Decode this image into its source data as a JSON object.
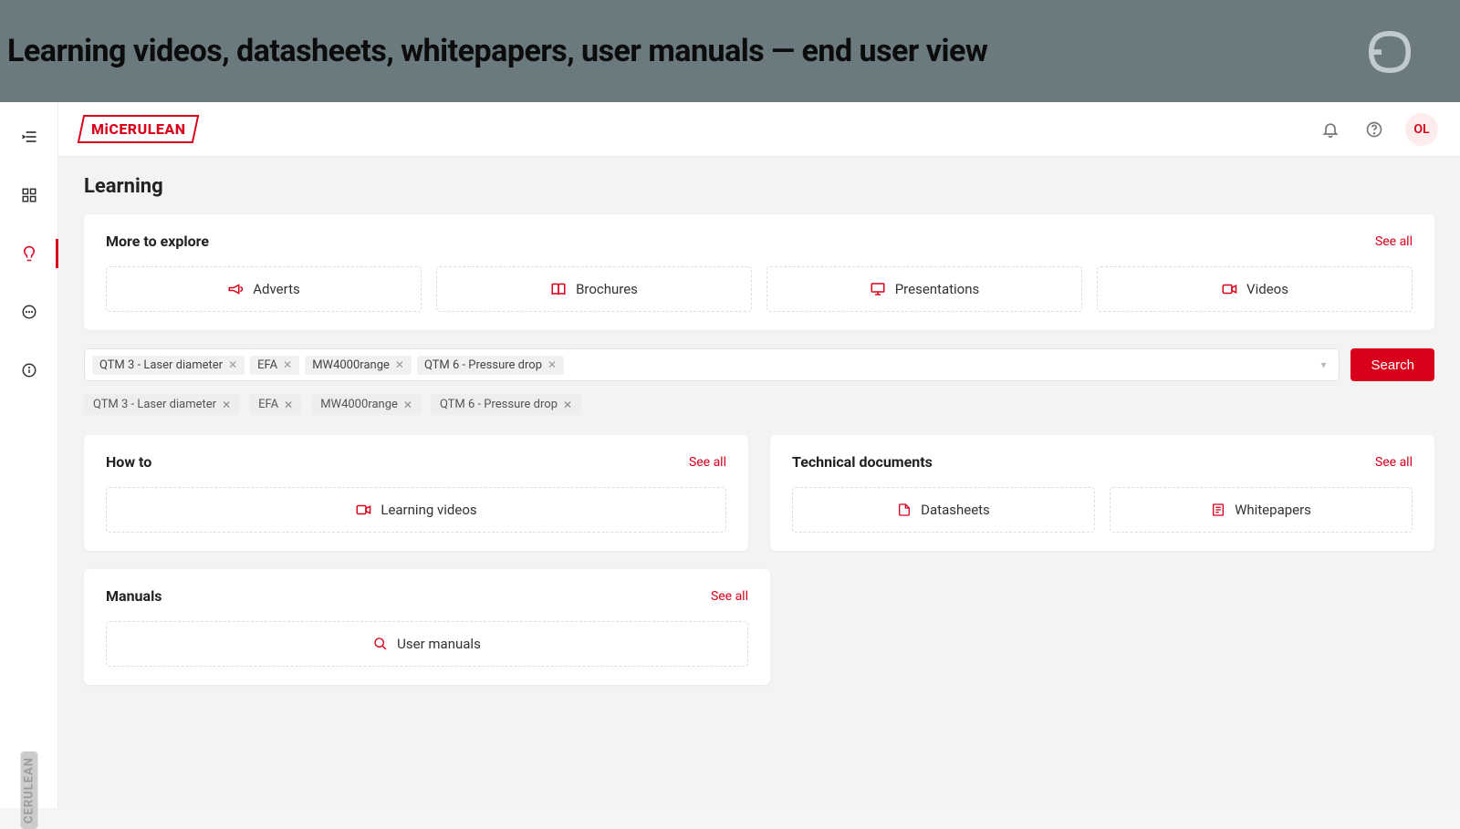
{
  "banner": {
    "title": "Learning videos, datasheets, whitepapers, user manuals — end user view"
  },
  "topbar": {
    "logo": "MiCERULEAN",
    "avatar": "OL"
  },
  "page": {
    "title": "Learning"
  },
  "explore": {
    "title": "More to explore",
    "see_all": "See all",
    "tiles": {
      "adverts": "Adverts",
      "brochures": "Brochures",
      "presentations": "Presentations",
      "videos": "Videos"
    }
  },
  "search": {
    "button": "Search",
    "chips": [
      "QTM 3 - Laser diameter",
      "EFA",
      "MW4000range",
      "QTM 6 - Pressure drop"
    ],
    "tags": [
      "QTM 3 - Laser diameter",
      "EFA",
      "MW4000range",
      "QTM 6 - Pressure drop"
    ]
  },
  "howto": {
    "title": "How to",
    "see_all": "See all",
    "tile": "Learning videos"
  },
  "techdocs": {
    "title": "Technical documents",
    "see_all": "See all",
    "tiles": {
      "datasheets": "Datasheets",
      "whitepapers": "Whitepapers"
    }
  },
  "manuals": {
    "title": "Manuals",
    "see_all": "See all",
    "tile": "User manuals"
  },
  "sidebar_brand": "CERULEAN"
}
